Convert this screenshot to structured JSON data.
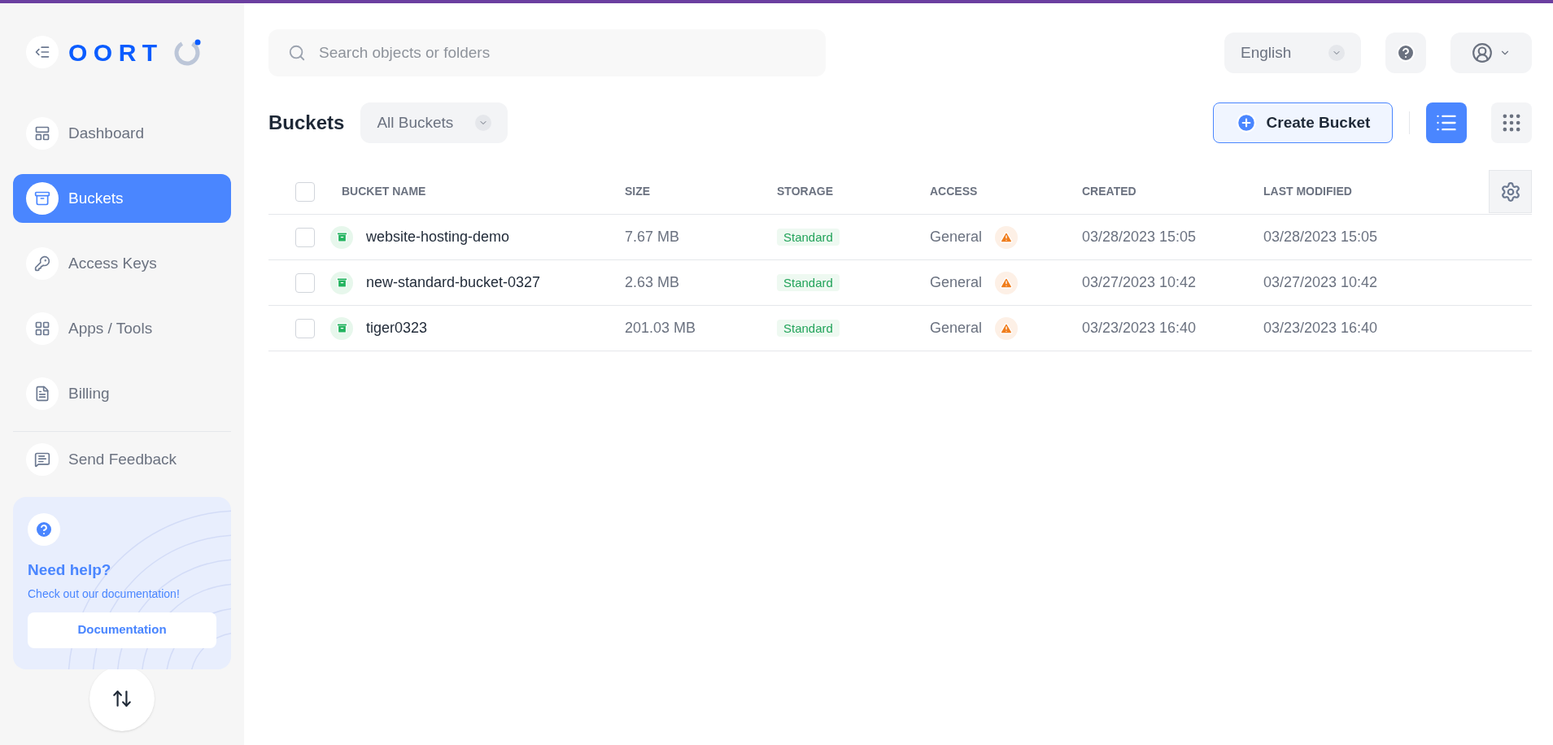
{
  "brand": {
    "name": "OORT"
  },
  "sidebar": {
    "items": [
      {
        "label": "Dashboard",
        "selected": false
      },
      {
        "label": "Buckets",
        "selected": true
      },
      {
        "label": "Access Keys",
        "selected": false
      },
      {
        "label": "Apps / Tools",
        "selected": false
      },
      {
        "label": "Billing",
        "selected": false
      }
    ],
    "footer_items": [
      {
        "label": "Send Feedback",
        "selected": false
      }
    ],
    "help_card": {
      "title": "Need help?",
      "text": "Check out our documentation!",
      "button": "Documentation"
    }
  },
  "search": {
    "placeholder": "Search objects or folders"
  },
  "language": {
    "value": "English"
  },
  "page": {
    "title": "Buckets",
    "filter": "All Buckets",
    "create_button": "Create Bucket",
    "views": [
      {
        "kind": "list",
        "selected": true
      },
      {
        "kind": "grid",
        "selected": false
      }
    ]
  },
  "table": {
    "select_all": {
      "checked": false
    },
    "columns": [
      "BUCKET NAME",
      "SIZE",
      "STORAGE",
      "ACCESS",
      "CREATED",
      "LAST MODIFIED"
    ],
    "rows": [
      {
        "checked": false,
        "name": "website-hosting-demo",
        "size": "7.67 MB",
        "storage": "Standard",
        "access": "General",
        "created": "03/28/2023 15:05",
        "modified": "03/28/2023 15:05"
      },
      {
        "checked": false,
        "name": "new-standard-bucket-0327",
        "size": "2.63 MB",
        "storage": "Standard",
        "access": "General",
        "created": "03/27/2023 10:42",
        "modified": "03/27/2023 10:42"
      },
      {
        "checked": false,
        "name": "tiger0323",
        "size": "201.03 MB",
        "storage": "Standard",
        "access": "General",
        "created": "03/23/2023 16:40",
        "modified": "03/23/2023 16:40"
      }
    ]
  }
}
